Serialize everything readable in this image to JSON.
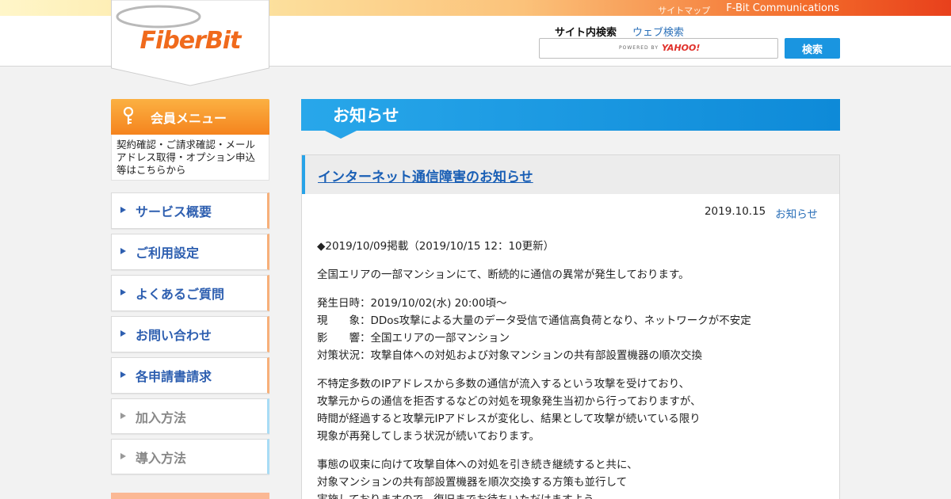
{
  "header": {
    "sitemap": "サイトマップ",
    "company": "F-Bit Communications",
    "logo_text": "FiberBit",
    "search": {
      "tab_site": "サイト内検索",
      "tab_web": "ウェブ検索",
      "powered": "POWERED BY",
      "provider": "YAHOO!",
      "button": "検索"
    }
  },
  "sidebar": {
    "member_title": "会員メニュー",
    "member_desc": "契約確認・ご請求確認・メールアドレス取得・オプション申込等はこちらから",
    "items": [
      {
        "label": "サービス概要"
      },
      {
        "label": "ご利用設定"
      },
      {
        "label": "よくあるご質問"
      },
      {
        "label": "お問い合わせ"
      },
      {
        "label": "各申請書請求"
      },
      {
        "label": "加入方法"
      },
      {
        "label": "導入方法"
      }
    ]
  },
  "main": {
    "section_title": "お知らせ",
    "article": {
      "title": "インターネット通信障害のお知らせ",
      "date": "2019.10.15",
      "category": "お知らせ",
      "paragraphs": [
        "◆2019/10/09掲載（2019/10/15 12：10更新）",
        "全国エリアの一部マンションにて、断続的に通信の異常が発生しております。",
        "発生日時：2019/10/02(水) 20:00頃～\n現　　象：DDos攻撃による大量のデータ受信で通信高負荷となり、ネットワークが不安定\n影　　響：全国エリアの一部マンション\n対策状況：攻撃自体への対処および対象マンションの共有部設置機器の順次交換",
        "不特定多数のIPアドレスから多数の通信が流入するという攻撃を受けており、\n攻撃元からの通信を拒否するなどの対処を現象発生当初から行っておりますが、\n時間が経過すると攻撃元IPアドレスが変化し、結果として攻撃が続いている限り\n現象が再発してしまう状況が続いております。",
        "事態の収束に向けて攻撃自体への対処を引き続き継続すると共に、\n対象マンションの共有部設置機器を順次交換する方策も並行して\n実施しておりますので、復旧までお待ちいただけますよう"
      ]
    }
  }
}
